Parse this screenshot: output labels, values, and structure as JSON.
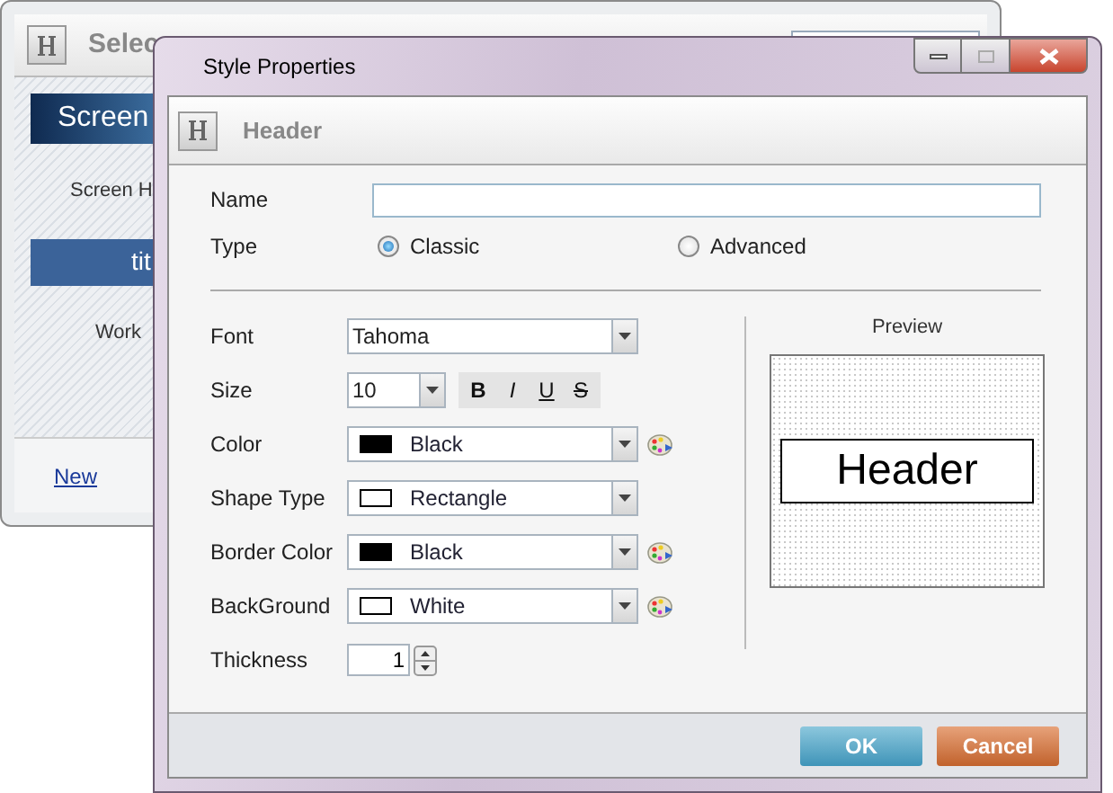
{
  "back_window": {
    "title": "Selec",
    "screen_button": "Screen",
    "screen_label": "Screen H",
    "title_button": "tit",
    "work_label": "Work",
    "new_link": "New"
  },
  "dialog": {
    "title": "Style Properties",
    "header": "Header",
    "name": {
      "label": "Name"
    },
    "type": {
      "label": "Type",
      "options": [
        {
          "label": "Classic",
          "selected": true
        },
        {
          "label": "Advanced",
          "selected": false
        }
      ]
    },
    "fields": [
      {
        "kind": "dropdown",
        "label": "Font",
        "value": "Tahoma",
        "palette": false
      },
      {
        "kind": "size",
        "label": "Size",
        "value": "10",
        "format_buttons": [
          "B",
          "I",
          "U",
          "S"
        ]
      },
      {
        "kind": "dropdown",
        "label": "Color",
        "value": "Black",
        "color": "#000000",
        "palette": true
      },
      {
        "kind": "dropdown",
        "label": "Shape Type",
        "value": "Rectangle",
        "color": "#ffffff",
        "palette": false
      },
      {
        "kind": "dropdown",
        "label": "Border Color",
        "value": "Black",
        "color": "#000000",
        "palette": true
      },
      {
        "kind": "dropdown",
        "label": "BackGround",
        "value": "White",
        "color": "#ffffff",
        "palette": true
      },
      {
        "kind": "spinner",
        "label": "Thickness",
        "value": "1"
      }
    ],
    "preview": {
      "label": "Preview",
      "sample": "Header"
    },
    "buttons": [
      {
        "kind": "ok",
        "label": "OK"
      },
      {
        "kind": "cancel",
        "label": "Cancel"
      }
    ]
  }
}
